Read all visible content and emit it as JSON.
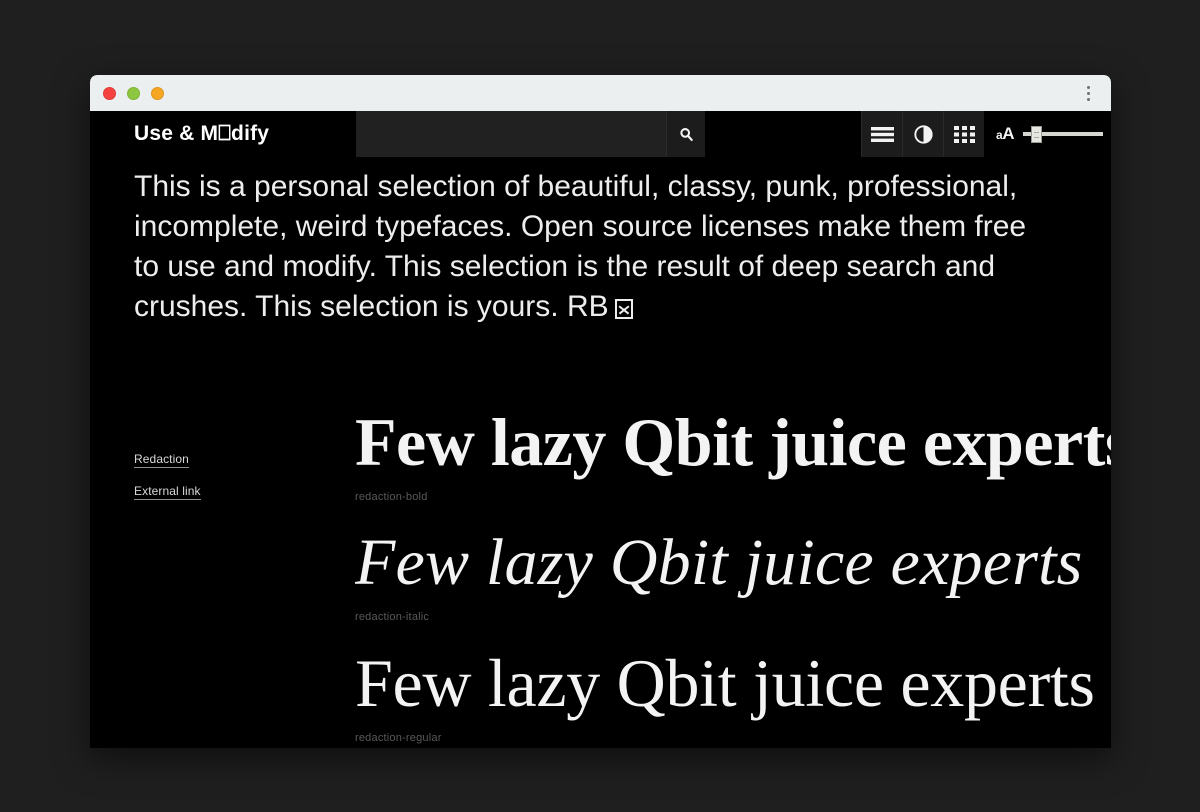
{
  "window": {
    "traffic_lights": [
      {
        "name": "close",
        "color": "#f5423f"
      },
      {
        "name": "minimize",
        "color": "#8dc63f"
      },
      {
        "name": "maximize",
        "color": "#f6a623"
      }
    ],
    "menu_icon": "kebab-menu-icon"
  },
  "toolbar": {
    "site_title": "Use & M⎕dify",
    "search_placeholder": "",
    "search_value": "",
    "search_icon": "search-icon",
    "buttons": [
      {
        "name": "hamburger-menu",
        "icon": "hamburger-icon"
      },
      {
        "name": "contrast-toggle",
        "icon": "contrast-icon"
      },
      {
        "name": "grid-view",
        "icon": "grid-icon"
      }
    ],
    "size_label_small": "a",
    "size_label_big": "A",
    "size_slider": {
      "name": "font-size-slider",
      "value": 12,
      "min": 0,
      "max": 100
    }
  },
  "intro": {
    "text": "This is a personal selection of beautiful, classy, punk, professional, incomplete, weird typefaces. Open source licenses make them free to use and modify. This selection is the result of deep search and crushes. This selection is yours. RB",
    "signature_icon": "boxed-x-icon"
  },
  "side_links": [
    {
      "label": "Redaction"
    },
    {
      "label": "External link"
    }
  ],
  "specimens": [
    {
      "sample": "Few lazy Qbit juice experts",
      "label": "redaction-bold",
      "style": "bold"
    },
    {
      "sample": "Few lazy Qbit juice experts",
      "label": "redaction-italic",
      "style": "italic"
    },
    {
      "sample": "Few lazy Qbit juice experts",
      "label": "redaction-regular",
      "style": "regular"
    }
  ],
  "colors": {
    "desktop_background": "#1f1f1f",
    "page_background": "#000000",
    "titlebar_background": "#eceff0",
    "text": "#ededed",
    "muted_text": "#595959"
  }
}
